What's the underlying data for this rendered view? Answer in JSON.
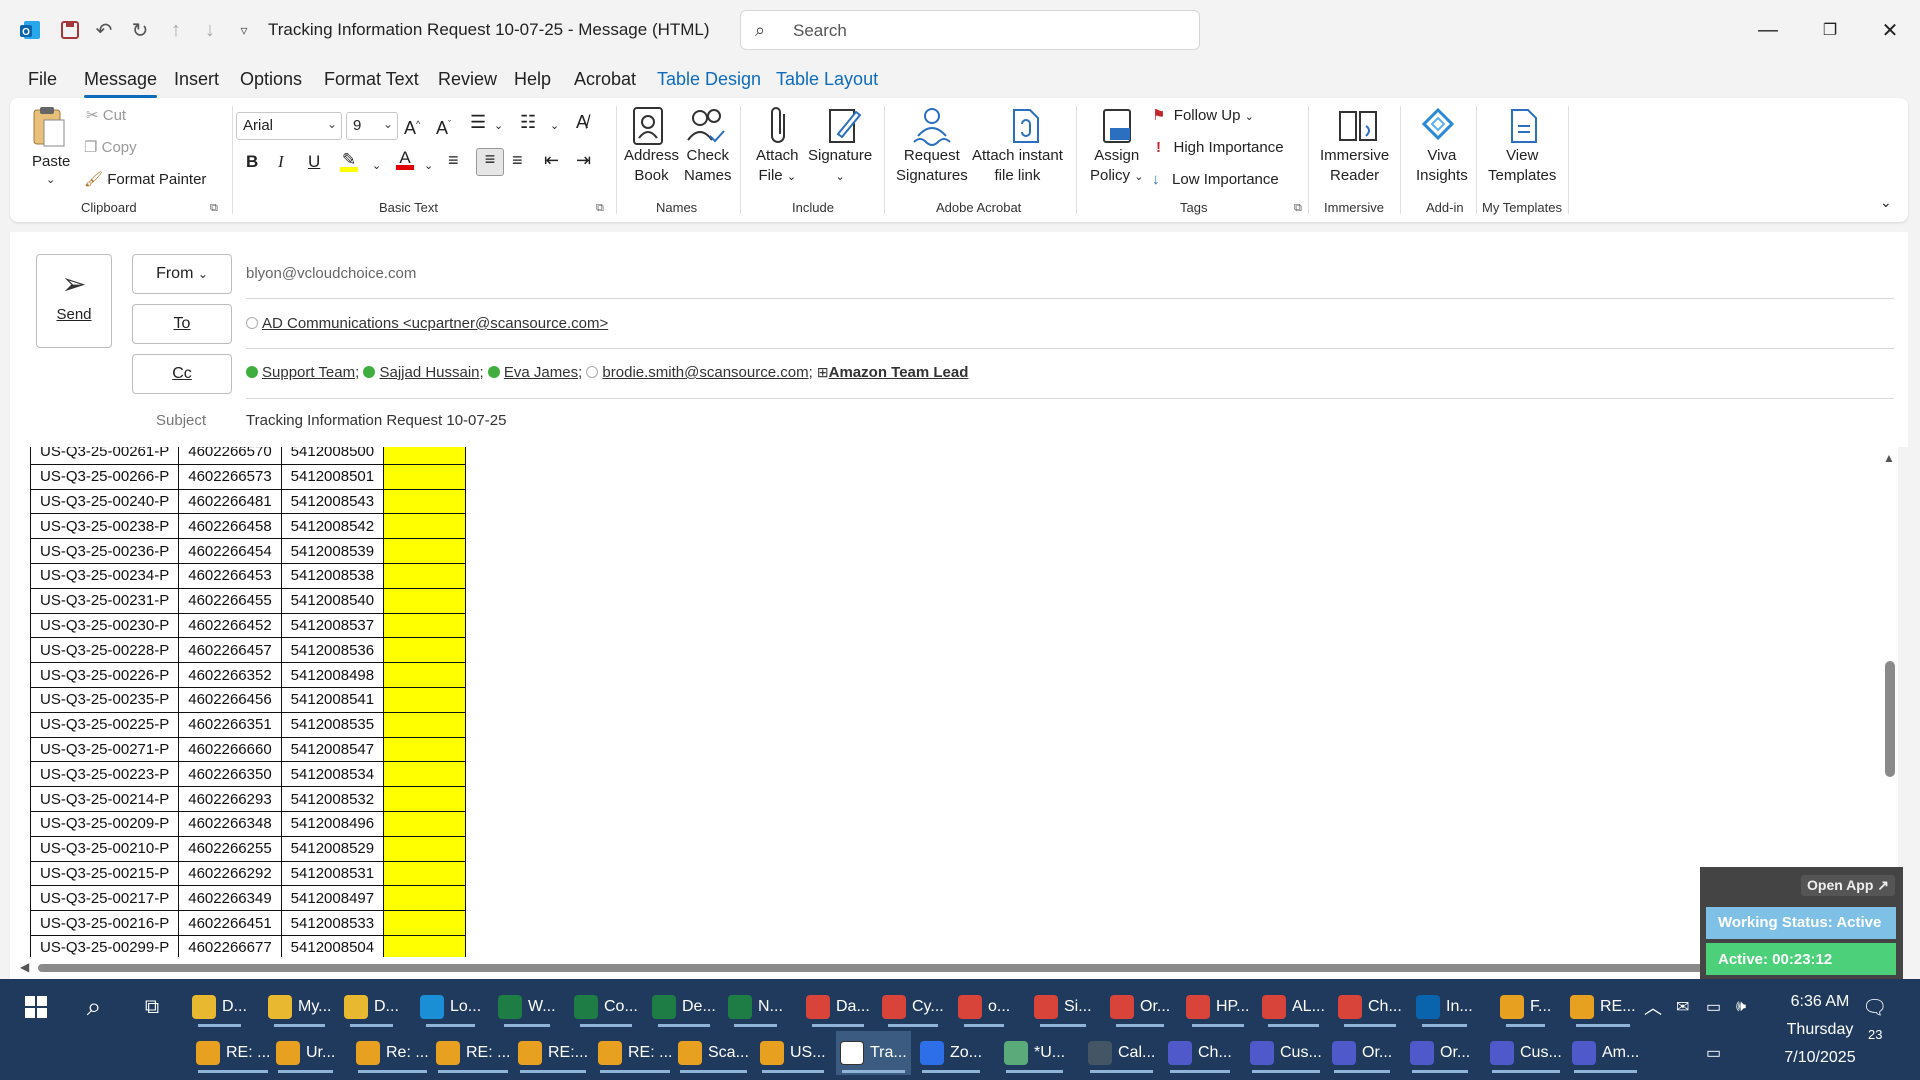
{
  "window": {
    "title": "Tracking Information Request  10-07-25  -  Message (HTML)",
    "search_placeholder": "Search"
  },
  "menu": [
    "File",
    "Message",
    "Insert",
    "Options",
    "Format Text",
    "Review",
    "Help",
    "Acrobat",
    "Table Design",
    "Table Layout"
  ],
  "ribbon": {
    "clipboard": {
      "paste": "Paste",
      "cut": "Cut",
      "copy": "Copy",
      "format_painter": "Format Painter",
      "label": "Clipboard"
    },
    "basic_text": {
      "font": "Arial",
      "size": "9",
      "label": "Basic Text"
    },
    "names": {
      "address_book_1": "Address",
      "address_book_2": "Book",
      "check_names_1": "Check",
      "check_names_2": "Names",
      "label": "Names"
    },
    "include": {
      "attach_1": "Attach",
      "attach_2": "File",
      "signature": "Signature",
      "label": "Include"
    },
    "adobe": {
      "req_1": "Request",
      "req_2": "Signatures",
      "link_1": "Attach instant",
      "link_2": "file link",
      "label": "Adobe Acrobat"
    },
    "tags": {
      "assign_1": "Assign",
      "assign_2": "Policy",
      "follow_up": "Follow Up",
      "high": "High Importance",
      "low": "Low Importance",
      "label": "Tags"
    },
    "immersive": {
      "reader_1": "Immersive",
      "reader_2": "Reader",
      "label": "Immersive"
    },
    "addin": {
      "viva_1": "Viva",
      "viva_2": "Insights",
      "label": "Add-in"
    },
    "templates": {
      "view_1": "View",
      "view_2": "Templates",
      "label": "My Templates"
    }
  },
  "header": {
    "send": "Send",
    "from_label": "From",
    "from_value": "blyon@vcloudchoice.com",
    "to_label": "To",
    "to_value": "AD Communications <ucpartner@scansource.com>",
    "cc_label": "Cc",
    "cc": [
      "Support Team",
      "Sajjad Hussain",
      "Eva James",
      "brodie.smith@scansource.com",
      "Amazon Team Lead"
    ],
    "subject_label": "Subject",
    "subject_value": "Tracking Information Request  10-07-25"
  },
  "table_rows": [
    [
      "US-Q3-25-00261-P",
      "4602266570",
      "5412008500"
    ],
    [
      "US-Q3-25-00266-P",
      "4602266573",
      "5412008501"
    ],
    [
      "US-Q3-25-00240-P",
      "4602266481",
      "5412008543"
    ],
    [
      "US-Q3-25-00238-P",
      "4602266458",
      "5412008542"
    ],
    [
      "US-Q3-25-00236-P",
      "4602266454",
      "5412008539"
    ],
    [
      "US-Q3-25-00234-P",
      "4602266453",
      "5412008538"
    ],
    [
      "US-Q3-25-00231-P",
      "4602266455",
      "5412008540"
    ],
    [
      "US-Q3-25-00230-P",
      "4602266452",
      "5412008537"
    ],
    [
      "US-Q3-25-00228-P",
      "4602266457",
      "5412008536"
    ],
    [
      "US-Q3-25-00226-P",
      "4602266352",
      "5412008498"
    ],
    [
      "US-Q3-25-00235-P",
      "4602266456",
      "5412008541"
    ],
    [
      "US-Q3-25-00225-P",
      "4602266351",
      "5412008535"
    ],
    [
      "US-Q3-25-00271-P",
      "4602266660",
      "5412008547"
    ],
    [
      "US-Q3-25-00223-P",
      "4602266350",
      "5412008534"
    ],
    [
      "US-Q3-25-00214-P",
      "4602266293",
      "5412008532"
    ],
    [
      "US-Q3-25-00209-P",
      "4602266348",
      "5412008496"
    ],
    [
      "US-Q3-25-00210-P",
      "4602266255",
      "5412008529"
    ],
    [
      "US-Q3-25-00215-P",
      "4602266292",
      "5412008531"
    ],
    [
      "US-Q3-25-00217-P",
      "4602266349",
      "5412008497"
    ],
    [
      "US-Q3-25-00216-P",
      "4602266451",
      "5412008533"
    ],
    [
      "US-Q3-25-00299-P",
      "4602266677",
      "5412008504"
    ]
  ],
  "widget": {
    "open_app": "Open App ↗",
    "status": "Working Status: Active",
    "active": "Active: 00:23:12"
  },
  "taskbar": {
    "row1": [
      "D...",
      "My...",
      "D...",
      "Lo...",
      "W...",
      "Co...",
      "De...",
      "N...",
      "Da...",
      "Cy...",
      "o...",
      "Si...",
      "Or...",
      "HP...",
      "AL...",
      "Ch...",
      "In...",
      "F...",
      "RE..."
    ],
    "row2": [
      "RE: ...",
      "Ur...",
      "Re: ...",
      "RE: ...",
      "RE:...",
      "RE: ...",
      "Sca...",
      "US...",
      "Tra...",
      "Zo...",
      "*U...",
      "Cal...",
      "Ch...",
      "Cus...",
      "Or...",
      "Or...",
      "Cus...",
      "Am..."
    ],
    "time": "6:36 AM",
    "day": "Thursday",
    "date": "7/10/2025",
    "notif_count": "23"
  }
}
